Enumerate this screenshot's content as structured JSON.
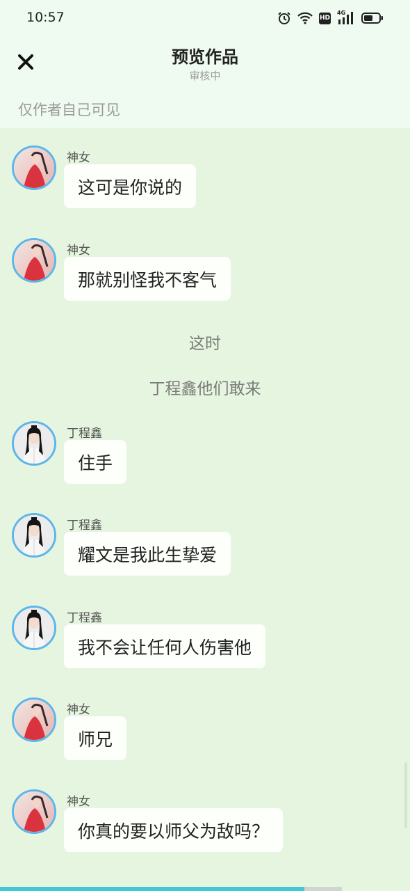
{
  "status_bar": {
    "time": "10:57",
    "icons": [
      "alarm-icon",
      "wifi-icon",
      "hd-icon",
      "4g-signal-icon",
      "battery-icon"
    ],
    "hd_label": "HD",
    "net_label": "4G"
  },
  "header": {
    "close_icon": "close-icon",
    "title": "预览作品",
    "subtitle": "审核中"
  },
  "visibility_note": "仅作者自己可见",
  "messages": [
    {
      "sender": "神女",
      "text": "这可是你说的"
    },
    {
      "sender": "神女",
      "text": "那就别怪我不客气"
    },
    {
      "narration": "这时"
    },
    {
      "narration": "丁程鑫他们敢来"
    },
    {
      "sender": "丁程鑫",
      "text": "住手"
    },
    {
      "sender": "丁程鑫",
      "text": "耀文是我此生挚爱"
    },
    {
      "sender": "丁程鑫",
      "text": "我不会让任何人伤害他"
    },
    {
      "sender": "神女",
      "text": "师兄"
    },
    {
      "sender": "神女",
      "text": "你真的要以师父为敌吗？"
    }
  ],
  "read_progress": 0.89,
  "colors": {
    "background": "#e6f5df",
    "header_bg": "#effaf0",
    "bubble": "#fcfffa",
    "avatar_ring": "#5cb6ea",
    "progress": "#43c6d8"
  }
}
